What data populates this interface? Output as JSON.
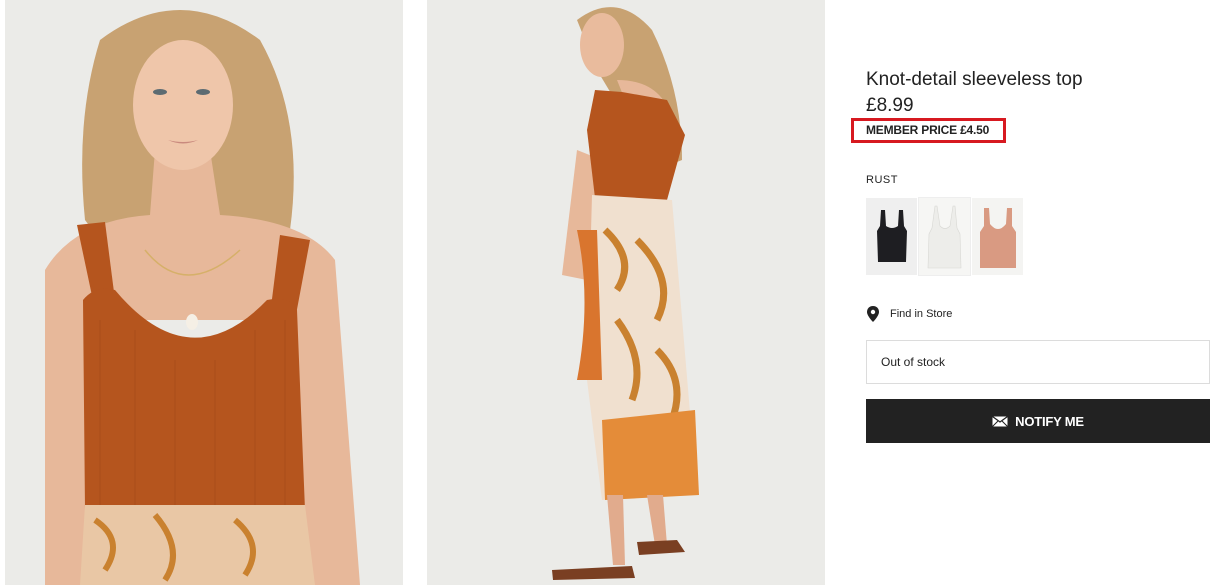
{
  "product": {
    "title": "Knot-detail sleeveless top",
    "price": "£8.99",
    "member_price": "MEMBER PRICE £4.50",
    "color_label": "RUST"
  },
  "swatches": [
    {
      "name": "black",
      "color": "#1e1e22"
    },
    {
      "name": "white",
      "color": "#f4f4f2"
    },
    {
      "name": "pink",
      "color": "#d99a82"
    }
  ],
  "store_link": {
    "label": "Find in Store",
    "icon": "location-pin-icon"
  },
  "stock_select": {
    "value": "Out of stock"
  },
  "notify_button": {
    "label": "NOTIFY ME",
    "icon": "envelope-icon"
  },
  "colors": {
    "highlight": "#d71920",
    "button": "#222222",
    "rust": "#b5551e"
  }
}
